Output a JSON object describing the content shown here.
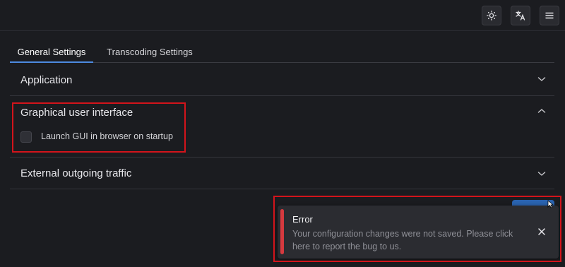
{
  "header": {
    "theme_toggle_icon": "sun-icon",
    "language_icon": "translate-icon",
    "menu_icon": "hamburger-menu-icon"
  },
  "tabs": [
    {
      "label": "General Settings",
      "active": true
    },
    {
      "label": "Transcoding Settings",
      "active": false
    }
  ],
  "sections": {
    "application": {
      "title": "Application",
      "expanded": false
    },
    "gui": {
      "title": "Graphical user interface",
      "expanded": true,
      "launch_checkbox_label": "Launch GUI in browser on startup",
      "launch_checked": false
    },
    "traffic": {
      "title": "External outgoing traffic",
      "expanded": false
    }
  },
  "toast": {
    "title": "Error",
    "message": "Your configuration changes were not saved. Please click here to report the bug to us."
  },
  "colors": {
    "background": "#1b1c20",
    "accent": "#4d8ae0",
    "error": "#d63a3f",
    "highlight_box": "#d3141b"
  }
}
